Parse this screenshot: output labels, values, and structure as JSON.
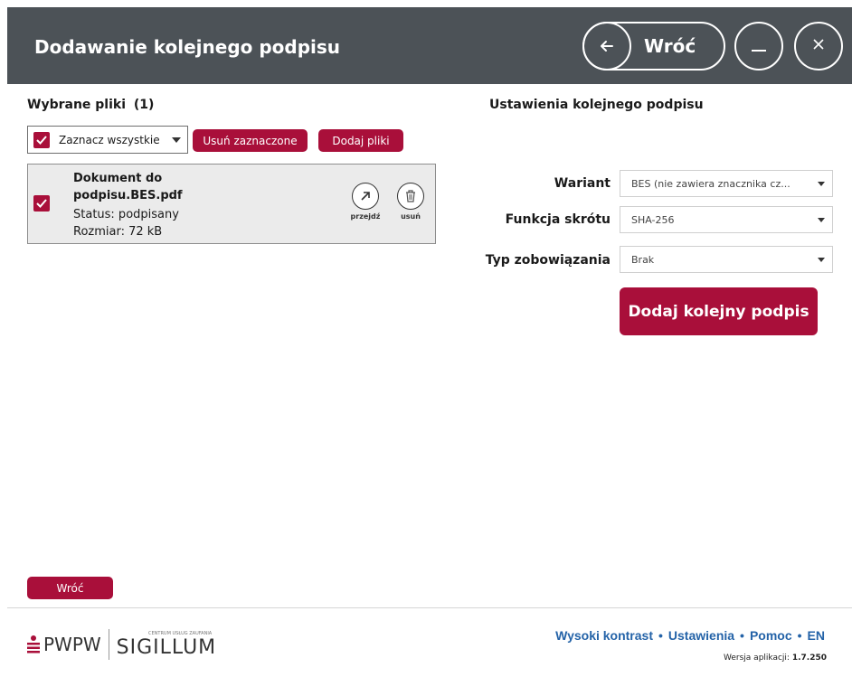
{
  "header": {
    "title": "Dodawanie kolejnego podpisu",
    "back_label": "Wróć",
    "back_icon": "arrow-left-icon",
    "minimize_icon": "minimize-icon",
    "close_icon": "close-icon"
  },
  "files": {
    "title": "Wybrane pliki",
    "count": "(1)",
    "select_all_label": "Zaznacz wszystkie",
    "remove_selected_label": "Usuń zaznaczone",
    "add_files_label": "Dodaj pliki",
    "items": [
      {
        "name": "Dokument do podpisu.BES.pdf",
        "status": "Status: podpisany",
        "size": "Rozmiar: 72 kB",
        "goto_label": "przejdź",
        "delete_label": "usuń",
        "checked": true
      }
    ]
  },
  "settings": {
    "title": "Ustawienia kolejnego podpisu",
    "variant_label": "Wariant",
    "variant_value": "BES (nie zawiera znacznika cz...",
    "hash_label": "Funkcja skrótu",
    "hash_value": "SHA-256",
    "commitment_label": "Typ zobowiązania",
    "commitment_value": "Brak",
    "add_signature_label": "Dodaj kolejny podpis"
  },
  "bottom": {
    "back_label": "Wróć"
  },
  "footer": {
    "logo_pwpw": "PWPW",
    "logo_small": "CENTRUM USŁUG ZAUFANIA",
    "logo_sigillum": "SIGILLUM",
    "links": [
      "Wysoki kontrast",
      "Ustawienia",
      "Pomoc",
      "EN"
    ],
    "version_label": "Wersja aplikacji:",
    "version_value": "1.7.250"
  },
  "colors": {
    "accent": "#a90f3a",
    "header_bg": "#4c5257",
    "link": "#2463a8"
  }
}
